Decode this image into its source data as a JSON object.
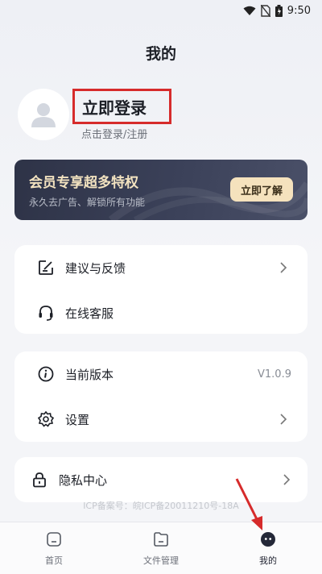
{
  "status_bar": {
    "time": "9:50"
  },
  "header": {
    "title": "我的"
  },
  "profile": {
    "login_title": "立即登录",
    "login_subtitle": "点击登录/注册"
  },
  "vip": {
    "title": "会员专享超多特权",
    "subtitle": "永久去广告、解锁所有功能",
    "button": "立即了解"
  },
  "menu_group1": [
    {
      "label": "建议与反馈",
      "icon": "feedback-edit-icon"
    },
    {
      "label": "在线客服",
      "icon": "headset-icon"
    }
  ],
  "menu_group2": [
    {
      "label": "当前版本",
      "icon": "info-icon",
      "value": "V1.0.9"
    },
    {
      "label": "设置",
      "icon": "gear-icon"
    }
  ],
  "menu_group3": [
    {
      "label": "隐私中心",
      "icon": "lock-icon"
    }
  ],
  "footer": {
    "icp": "ICP备案号：皖ICP备20011210号-18A"
  },
  "bottom_nav": [
    {
      "label": "首页",
      "icon": "home-icon"
    },
    {
      "label": "文件管理",
      "icon": "folder-icon"
    },
    {
      "label": "我的",
      "icon": "profile-icon",
      "active": true
    }
  ],
  "colors": {
    "accent_red": "#d62b2b",
    "vip_gold": "#f3e3c0",
    "active_nav": "#1f2230"
  }
}
